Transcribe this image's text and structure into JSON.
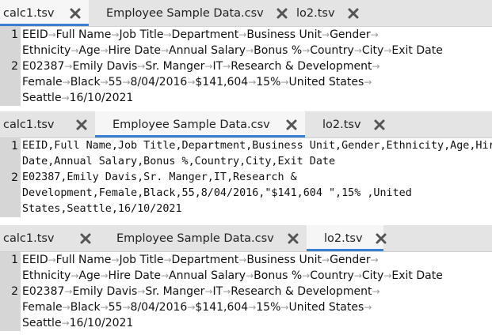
{
  "panels": [
    {
      "tabs": [
        {
          "label": "calc1.tsv",
          "active": true
        },
        {
          "label": "Employee Sample Data.csv",
          "active": false
        },
        {
          "label": "lo2.tsv",
          "active": false
        }
      ],
      "mode": "tsv",
      "lines": [
        {
          "num": "1",
          "rows": [
            [
              "EEID",
              "Full Name",
              "Job Title",
              "Department",
              "Business Unit",
              "Gender"
            ],
            [
              "Ethnicity",
              "Age",
              "Hire Date",
              "Annual Salary",
              "Bonus %",
              "Country",
              "City",
              "Exit Date"
            ]
          ]
        },
        {
          "num": "2",
          "rows": [
            [
              "E02387",
              "Emily Davis",
              "Sr. Manger",
              "IT",
              "Research & Development"
            ],
            [
              "Female",
              "Black",
              "55",
              "8/04/2016",
              "$141,604",
              "15%",
              "United States"
            ],
            [
              "Seattle",
              "16/10/2021"
            ]
          ]
        }
      ]
    },
    {
      "tabs": [
        {
          "label": "calc1.tsv",
          "active": false
        },
        {
          "label": "Employee Sample Data.csv",
          "active": true
        },
        {
          "label": "lo2.tsv",
          "active": false
        }
      ],
      "mode": "csv",
      "lines": [
        {
          "num": "1",
          "rows": [
            [
              "EEID,Full Name,Job Title,Department,Business Unit,Gender,Ethnicity,Age,Hire"
            ],
            [
              "Date,Annual Salary,Bonus %,Country,City,Exit Date"
            ]
          ]
        },
        {
          "num": "2",
          "rows": [
            [
              "E02387,Emily Davis,Sr. Manger,IT,Research &"
            ],
            [
              "Development,Female,Black,55,8/04/2016,\"$141,604 \",15% ,United"
            ],
            [
              "States,Seattle,16/10/2021"
            ]
          ]
        }
      ]
    },
    {
      "tabs": [
        {
          "label": "calc1.tsv",
          "active": false
        },
        {
          "label": "Employee Sample Data.csv",
          "active": false
        },
        {
          "label": "lo2.tsv",
          "active": true
        }
      ],
      "mode": "tsv",
      "lines": [
        {
          "num": "1",
          "rows": [
            [
              "EEID",
              "Full Name",
              "Job Title",
              "Department",
              "Business Unit",
              "Gender"
            ],
            [
              "Ethnicity",
              "Age",
              "Hire Date",
              "Annual Salary",
              "Bonus %",
              "Country",
              "City",
              "Exit Date"
            ]
          ]
        },
        {
          "num": "2",
          "rows": [
            [
              "E02387",
              "Emily Davis",
              "Sr. Manger",
              "IT",
              "Research & Development"
            ],
            [
              "Female",
              "Black",
              "55",
              "8/04/2016",
              "$141,604",
              "15%",
              "United States"
            ],
            [
              "Seattle",
              "16/10/2021"
            ]
          ]
        }
      ]
    }
  ],
  "icons": {
    "close": "close-x-icon",
    "tab_arrow": "tab-arrow-icon"
  },
  "colors": {
    "active_tab_underline": "#3b7fd0",
    "gutter": "#d6d6d6",
    "tabbar": "#e4e4e4"
  }
}
